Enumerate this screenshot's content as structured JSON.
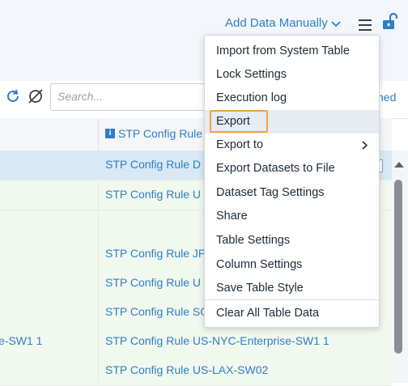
{
  "header": {
    "add_data_label": "Add Data Manually",
    "search_placeholder": "Search...",
    "pinned_fragment": "ned"
  },
  "table": {
    "column_header": "STP Config Rule",
    "rows": [
      {
        "c1": "",
        "c2": "STP Config Rule D",
        "selected": true
      },
      {
        "c1": "",
        "c2": "STP Config Rule U"
      },
      {
        "c1": "",
        "c2": ""
      },
      {
        "c1": "",
        "c2": "STP Config Rule JP"
      },
      {
        "c1": "",
        "c2": "STP Config Rule U"
      },
      {
        "c1": "",
        "c2": "STP Config Rule SG"
      },
      {
        "c1": "e-SW1 1",
        "c2": "STP Config Rule US-NYC-Enterprise-SW1 1"
      },
      {
        "c1": "",
        "c2": "STP Config Rule US-LAX-SW02"
      }
    ]
  },
  "menu": {
    "items": [
      {
        "label": "Import from System Table"
      },
      {
        "label": "Lock Settings"
      },
      {
        "label": "Execution log"
      },
      {
        "label": "Export"
      },
      {
        "label": "Export to"
      },
      {
        "label": "Export Datasets to File"
      },
      {
        "label": "Dataset Tag Settings"
      },
      {
        "label": "Share"
      },
      {
        "label": "Table Settings"
      },
      {
        "label": "Column Settings"
      },
      {
        "label": "Save Table Style"
      },
      {
        "label": "Clear All Table Data"
      }
    ]
  },
  "colors": {
    "accent": "#2f7ec4",
    "highlight_outline": "#f2a23a",
    "selected_row": "#d8e8f5",
    "row_tint": "#f1f8ee"
  },
  "icons": [
    "chevron-down-icon",
    "hamburger-menu-icon",
    "unlock-icon",
    "refresh-icon",
    "hide-icon",
    "info-icon",
    "chevron-right-icon",
    "scroll-up-arrow-icon"
  ]
}
